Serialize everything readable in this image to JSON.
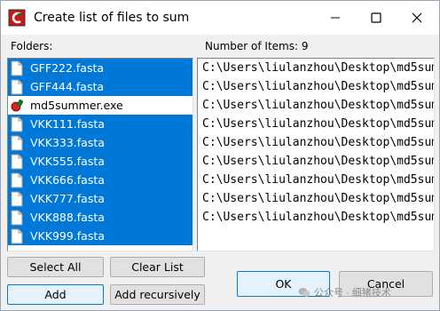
{
  "window": {
    "title": "Create list of files to sum"
  },
  "titlebar": {
    "minimize_glyph": "—",
    "maximize_glyph": "☐",
    "close_glyph": "✕"
  },
  "labels": {
    "folders": "Folders:",
    "items_count": "Number of Items: 9"
  },
  "files": [
    {
      "name": "GFF222.fasta",
      "selected": true,
      "icon": "file-icon"
    },
    {
      "name": "GFF444.fasta",
      "selected": true,
      "icon": "file-icon"
    },
    {
      "name": "md5summer.exe",
      "selected": false,
      "icon": "md5summer-app-icon"
    },
    {
      "name": "VKK111.fasta",
      "selected": true,
      "icon": "file-icon"
    },
    {
      "name": "VKK333.fasta",
      "selected": true,
      "icon": "file-icon"
    },
    {
      "name": "VKK555.fasta",
      "selected": true,
      "icon": "file-icon"
    },
    {
      "name": "VKK666.fasta",
      "selected": true,
      "icon": "file-icon"
    },
    {
      "name": "VKK777.fasta",
      "selected": true,
      "icon": "file-icon"
    },
    {
      "name": "VKK888.fasta",
      "selected": true,
      "icon": "file-icon"
    },
    {
      "name": "VKK999.fasta",
      "selected": true,
      "icon": "file-icon"
    }
  ],
  "items": [
    "C:\\Users\\liulanzhou\\Desktop\\md5sum",
    "C:\\Users\\liulanzhou\\Desktop\\md5sum",
    "C:\\Users\\liulanzhou\\Desktop\\md5sum",
    "C:\\Users\\liulanzhou\\Desktop\\md5sum",
    "C:\\Users\\liulanzhou\\Desktop\\md5sum",
    "C:\\Users\\liulanzhou\\Desktop\\md5sum",
    "C:\\Users\\liulanzhou\\Desktop\\md5sum",
    "C:\\Users\\liulanzhou\\Desktop\\md5sum",
    "C:\\Users\\liulanzhou\\Desktop\\md5sum"
  ],
  "buttons": {
    "select_all": "Select All",
    "clear_list": "Clear List",
    "add": "Add",
    "add_recursively": "Add recursively",
    "ok": "OK",
    "cancel": "Cancel"
  },
  "watermark": {
    "text": "公众号 · 细猪技术"
  },
  "colors": {
    "selection": "#0078d7",
    "focus_border": "#0078d7"
  }
}
